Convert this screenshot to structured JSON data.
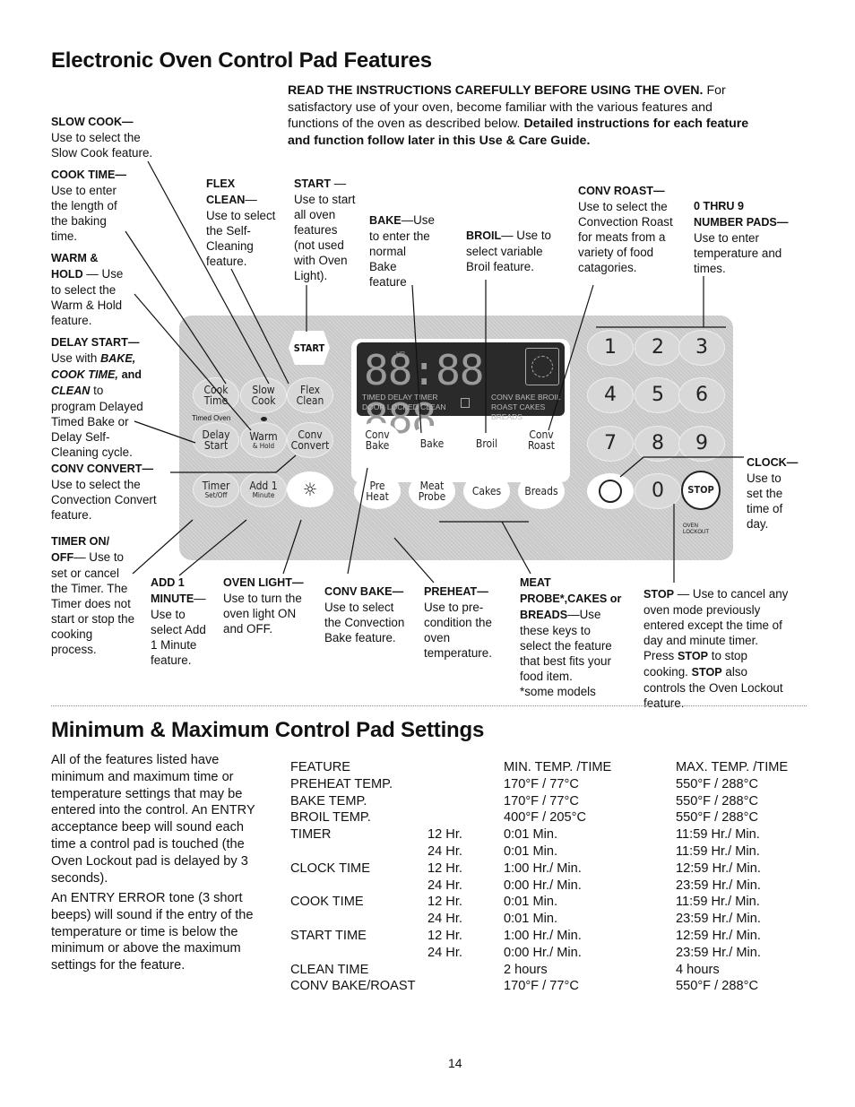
{
  "section1": {
    "title": "Electronic Oven Control Pad Features",
    "intro_lines": [
      "**READ THE INSTRUCTIONS CAREFULLY BEFORE USING THE OVEN.** For",
      "satisfactory use of your oven, become familiar with the various features and",
      "functions of the oven as described below. **Detailed instructions for each feature**",
      "**and function follow later in this Use & Care Guide.**"
    ],
    "callouts": [
      {
        "id": "slow-cook",
        "lines": [
          "**SLOW COOK—**",
          "Use to select the",
          "Slow Cook  feature."
        ]
      },
      {
        "id": "cook-time",
        "lines": [
          "**COOK TIME—**",
          "Use to enter",
          "the length of",
          "the baking",
          "time."
        ]
      },
      {
        "id": "warm-hold",
        "lines": [
          "**WARM &**",
          "**HOLD** — Use",
          "to select the",
          "Warm & Hold",
          "feature."
        ]
      },
      {
        "id": "delay-start",
        "lines": [
          "**DELAY START—**",
          "Use with __BAKE,__",
          "__COOK TIME,__ **and**",
          "__CLEAN__ to",
          "program Delayed",
          "Timed Bake or",
          "Delay Self-",
          "Cleaning cycle."
        ]
      },
      {
        "id": "conv-convert",
        "lines": [
          "**CONV CONVERT—**",
          "Use to select the",
          "Convection Convert",
          "feature."
        ]
      },
      {
        "id": "timer",
        "lines": [
          "**TIMER ON/**",
          "**OFF**— Use to",
          "set or cancel",
          "the Timer. The",
          "Timer does not",
          "start or stop the",
          "cooking",
          "process."
        ]
      },
      {
        "id": "flex-clean",
        "lines": [
          "**FLEX**",
          "**CLEAN**—",
          "Use to select",
          "the Self-",
          "Cleaning",
          "feature."
        ]
      },
      {
        "id": "start",
        "lines": [
          "**START** —",
          "Use to start",
          "all oven",
          "features",
          "(not used",
          "with Oven",
          "Light)."
        ]
      },
      {
        "id": "bake",
        "lines": [
          "**BAKE**—Use",
          "to enter the",
          "normal",
          "Bake",
          "feature"
        ]
      },
      {
        "id": "broil",
        "lines": [
          "**BROIL**— Use to",
          "select variable",
          "Broil feature."
        ]
      },
      {
        "id": "conv-roast",
        "lines": [
          "**CONV ROAST—**",
          "Use to select the",
          "Convection Roast",
          "for meats from a",
          "variety of food",
          "catagories."
        ]
      },
      {
        "id": "number-pads",
        "lines": [
          "**0 THRU 9**",
          "**NUMBER PADS—**",
          "Use to enter",
          "temperature  and",
          "times."
        ]
      },
      {
        "id": "clock",
        "lines": [
          "**CLOCK—**",
          "Use  to",
          "set the",
          "time of",
          "day."
        ]
      },
      {
        "id": "add-1-minute",
        "lines": [
          "**ADD 1**",
          "**MINUTE**—",
          "Use to",
          "select Add",
          "1 Minute",
          "feature."
        ]
      },
      {
        "id": "oven-light",
        "lines": [
          "**OVEN LIGHT—**",
          "Use to turn the",
          "oven light ON",
          "and OFF."
        ]
      },
      {
        "id": "conv-bake",
        "lines": [
          "**CONV BAKE—**",
          "Use to select",
          "the Convection",
          "Bake feature."
        ]
      },
      {
        "id": "preheat",
        "lines": [
          "**PREHEAT—**",
          "Use to pre-",
          "condition the",
          "oven",
          "temperature."
        ]
      },
      {
        "id": "meat-probe",
        "lines": [
          "**MEAT**",
          "**PROBE*,CAKES or**",
          "**BREADS**—Use",
          "these keys to",
          "select the feature",
          "that best fits your",
          "food item.",
          "*some  models"
        ]
      },
      {
        "id": "stop",
        "lines": [
          "**STOP** — Use to cancel any",
          "oven mode previously",
          "entered except the time of",
          "day and minute timer.",
          "Press **STOP** to stop",
          "cooking. **STOP** also",
          "controls the Oven Lockout",
          "feature."
        ]
      }
    ]
  },
  "panel": {
    "start": "START",
    "display_digits": "88:88 888",
    "display_hr": "HR",
    "indicators_row1": "TIMED  DELAY  TIMER",
    "indicators_row2": "DOOR  LOCKED  CLEAN",
    "indicators_row3": "CONV  BAKE  BROIL",
    "indicators_row4": "ROAST CAKES BREADS",
    "timed_oven": "Timed Oven",
    "oven_lockout": "OVEN LOCKOUT",
    "buttons": [
      {
        "l1": "Cook",
        "l2": "Time"
      },
      {
        "l1": "Slow",
        "l2": "Cook"
      },
      {
        "l1": "Flex",
        "l2": "Clean"
      },
      {
        "l1": "Delay",
        "l2": "Start"
      },
      {
        "l1": "Warm",
        "s": "& Hold"
      },
      {
        "l1": "Conv",
        "l2": "Convert"
      },
      {
        "l1": "Timer",
        "s": "Set/Off"
      },
      {
        "l1": "Add 1",
        "s": "Minute"
      },
      {
        "l1": "Conv",
        "l2": "Bake"
      },
      {
        "l1": "Bake"
      },
      {
        "l1": "Broil"
      },
      {
        "l1": "Conv",
        "l2": "Roast"
      },
      {
        "l1": "Pre",
        "l2": "Heat"
      },
      {
        "l1": "Meat",
        "l2": "Probe"
      },
      {
        "l1": "Cakes"
      },
      {
        "l1": "Breads"
      }
    ],
    "numbers": [
      "1",
      "2",
      "3",
      "4",
      "5",
      "6",
      "7",
      "8",
      "9",
      "0"
    ],
    "stop": "STOP",
    "icons": {
      "light": "light-bulb-icon",
      "clock": "clock-icon",
      "lock": "lock-icon",
      "fan": "convection-fan-icon"
    }
  },
  "section2": {
    "title": "Minimum & Maximum Control Pad Settings",
    "paragraph1": [
      "All of the features listed have",
      "minimum and maximum time or",
      "temperature settings that may be",
      "entered into the control.  An ENTRY",
      "acceptance beep will sound each",
      "time a control pad is touched (the",
      "Oven Lockout pad is delayed by 3",
      "seconds)."
    ],
    "paragraph2": [
      "An ENTRY ERROR tone (3 short",
      "beeps) will sound if the entry of the",
      "temperature or time is below the",
      "minimum or above the maximum",
      "settings for the feature."
    ],
    "table": {
      "headers": [
        "FEATURE",
        "",
        "MIN. TEMP. /TIME",
        "MAX. TEMP. /TIME"
      ],
      "rows": [
        [
          "PREHEAT TEMP.",
          "",
          "170°F / 77°C",
          "550°F / 288°C"
        ],
        [
          "BAKE  TEMP.",
          "",
          "170°F / 77°C",
          "550°F / 288°C"
        ],
        [
          "BROIL TEMP.",
          "",
          "400°F / 205°C",
          "550°F / 288°C"
        ],
        [
          "TIMER",
          "12 Hr.",
          "0:01 Min.",
          "11:59 Hr./ Min."
        ],
        [
          "",
          "24 Hr.",
          "0:01 Min.",
          "11:59 Hr./ Min."
        ],
        [
          "CLOCK TIME",
          "12 Hr.",
          "1:00 Hr./ Min.",
          "12:59 Hr./ Min."
        ],
        [
          "",
          "24 Hr.",
          "0:00 Hr./ Min.",
          "23:59 Hr./ Min."
        ],
        [
          "COOK TIME",
          "12 Hr.",
          "0:01 Min.",
          "11:59 Hr./ Min."
        ],
        [
          "",
          "24 Hr.",
          "0:01 Min.",
          "23:59 Hr./ Min."
        ],
        [
          "START TIME",
          "12 Hr.",
          "1:00 Hr./ Min.",
          "12:59 Hr./ Min."
        ],
        [
          "",
          "24 Hr.",
          "0:00 Hr./ Min.",
          "23:59 Hr./ Min."
        ],
        [
          "CLEAN TIME",
          "",
          "2 hours",
          "4 hours"
        ],
        [
          "CONV BAKE/ROAST",
          "",
          "170°F / 77°C",
          "550°F / 288°C"
        ]
      ]
    }
  },
  "page_number": "14"
}
